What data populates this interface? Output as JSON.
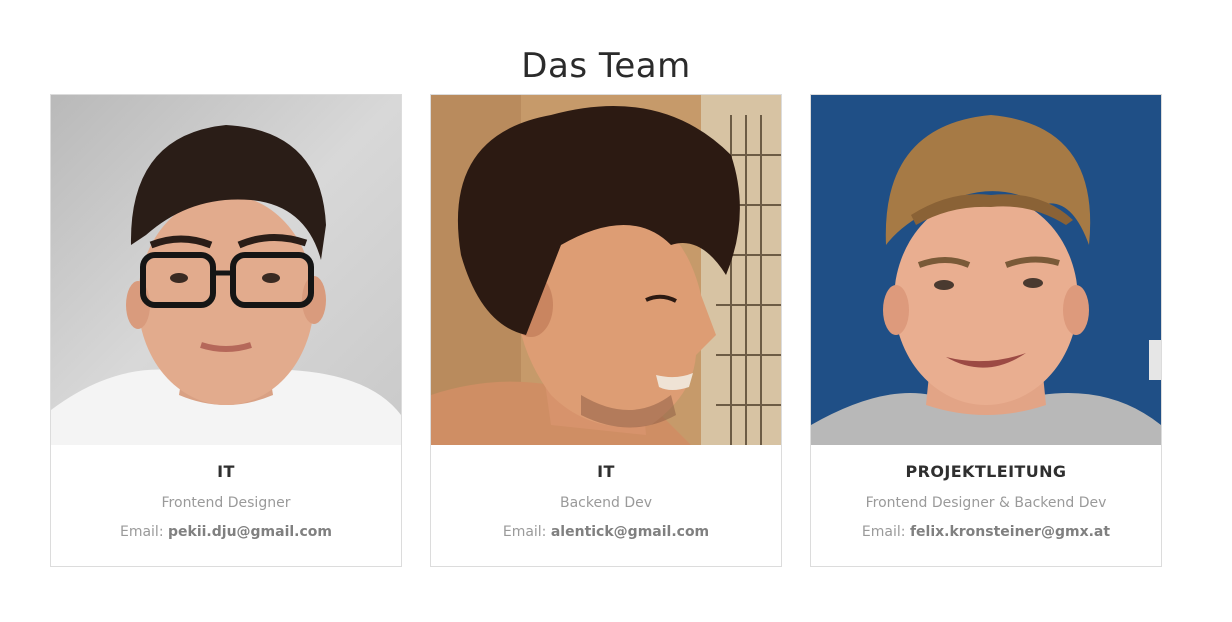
{
  "section": {
    "title": "Das Team"
  },
  "members": [
    {
      "role": "IT",
      "position": "Frontend Designer",
      "email_label": "Email:",
      "email": "pekii.dju@gmail.com",
      "photo_icon": "portrait-photo"
    },
    {
      "role": "IT",
      "position": "Backend Dev",
      "email_label": "Email:",
      "email": "alentick@gmail.com",
      "photo_icon": "portrait-photo"
    },
    {
      "role": "PROJEKTLEITUNG",
      "position": "Frontend Designer & Backend Dev",
      "email_label": "Email:",
      "email": "felix.kronsteiner@gmx.at",
      "photo_icon": "portrait-photo"
    }
  ],
  "colors": {
    "title": "#2b2b2b",
    "role": "#2f2f2f",
    "muted_text": "#9a9a9a",
    "card_border": "#dcdcdc",
    "photo3_background": "#1f4f86"
  }
}
